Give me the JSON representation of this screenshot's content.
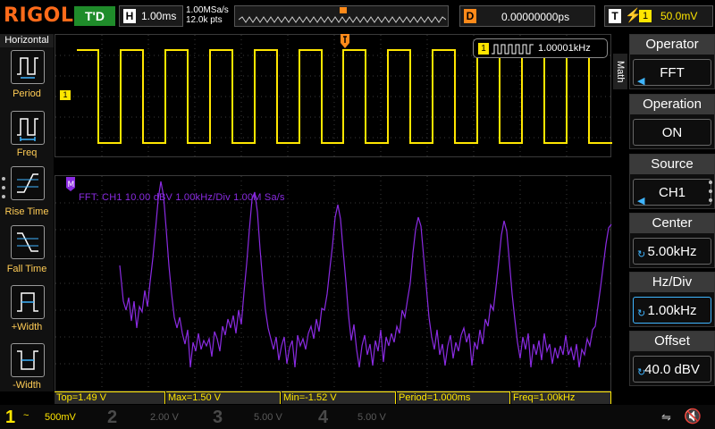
{
  "brand": "RIGOL",
  "status": {
    "run_state": "T'D"
  },
  "timebase": {
    "key": "H",
    "value": "1.00ms"
  },
  "acquisition": {
    "sample_rate": "1.00MSa/s",
    "memory_depth": "12.0k pts"
  },
  "delay": {
    "key": "D",
    "value": "0.00000000ps"
  },
  "trigger": {
    "key": "T",
    "channel": "1",
    "level": "50.0mV"
  },
  "left_menu": {
    "header": "Horizontal",
    "items": [
      {
        "label": "Period",
        "icon": "period-icon"
      },
      {
        "label": "Freq",
        "icon": "frequency-icon"
      },
      {
        "label": "Rise Time",
        "icon": "rise-time-icon"
      },
      {
        "label": "Fall Time",
        "icon": "fall-time-icon"
      },
      {
        "label": "+Width",
        "icon": "positive-width-icon"
      },
      {
        "label": "-Width",
        "icon": "negative-width-icon"
      }
    ]
  },
  "waveform": {
    "channel_marker": "1",
    "frequency_badge": {
      "channel": "1",
      "value": "1.00001kHz"
    }
  },
  "fft": {
    "label": "FFT: CH1 10.00 dBV   1.00kHz/Div   1.00M Sa/s"
  },
  "measurements": [
    "Top=1.49 V",
    "Max=1.50 V",
    "Min=-1.52 V",
    "Period=1.000ms",
    "Freq=1.00kHz"
  ],
  "right_menu": {
    "tab": "Math",
    "items": [
      {
        "title": "Operator",
        "value": "FFT"
      },
      {
        "title": "Operation",
        "value": "ON"
      },
      {
        "title": "Source",
        "value": "CH1"
      },
      {
        "title": "Center",
        "value": "5.00kHz"
      },
      {
        "title": "Hz/Div",
        "value": "1.00kHz"
      },
      {
        "title": "Offset",
        "value": "40.0 dBV"
      }
    ]
  },
  "channels": [
    {
      "num": "1",
      "coupling": "~",
      "scale": "500mV",
      "enabled": true
    },
    {
      "num": "2",
      "coupling": "",
      "scale": "2.00 V",
      "enabled": false
    },
    {
      "num": "3",
      "coupling": "",
      "scale": "5.00 V",
      "enabled": false
    },
    {
      "num": "4",
      "coupling": "",
      "scale": "5.00 V",
      "enabled": false
    }
  ],
  "colors": {
    "ch1": "#ffe600",
    "math": "#8a2be2",
    "trigger": "#ff8a1a",
    "brand": "#ff6b1a",
    "run": "#1f8c2a"
  }
}
